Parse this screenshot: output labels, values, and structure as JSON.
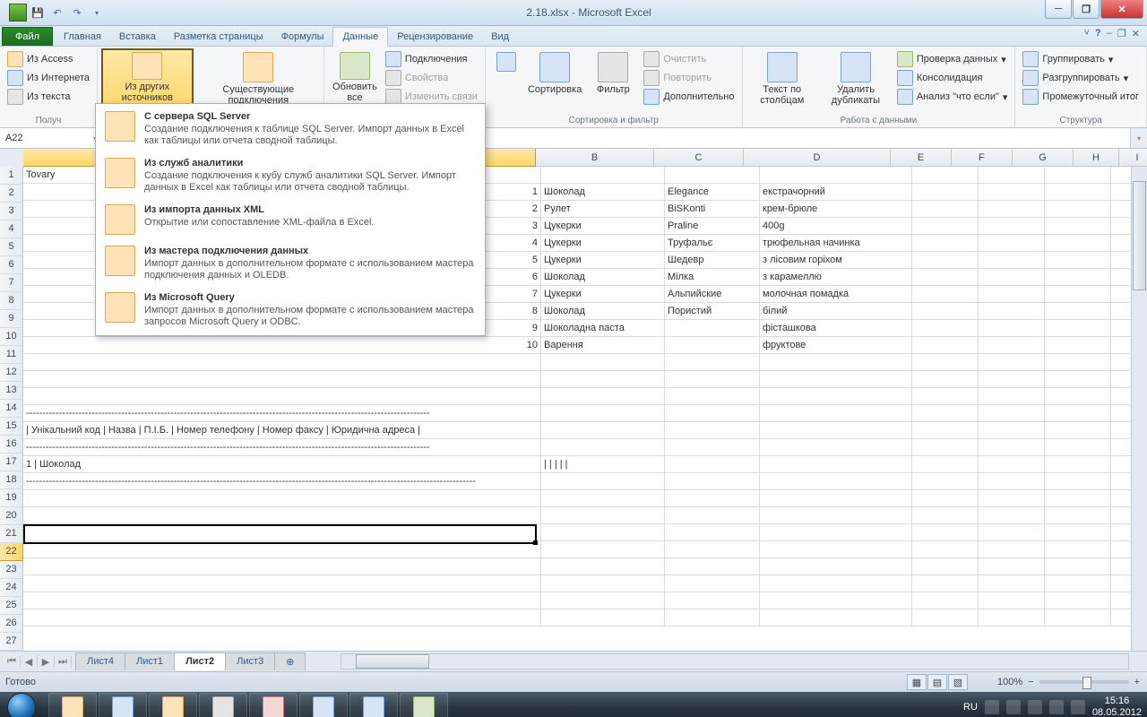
{
  "title_bar": {
    "title": "2.18.xlsx - Microsoft Excel"
  },
  "qat": {
    "save": "💾",
    "undo": "↶",
    "redo": "↷"
  },
  "tabs": {
    "file": "Файл",
    "items": [
      "Главная",
      "Вставка",
      "Разметка страницы",
      "Формулы",
      "Данные",
      "Рецензирование",
      "Вид"
    ],
    "active_index": 4
  },
  "ribbon": {
    "group_get": {
      "label": "Получ",
      "access": "Из Access",
      "web": "Из Интернета",
      "text": "Из текста",
      "other": "Из других источников",
      "existing": "Существующие подключения"
    },
    "group_conn": {
      "refresh": "Обновить все",
      "connections": "Подключения",
      "properties": "Свойства",
      "edit_links": "Изменить связи"
    },
    "group_sort": {
      "label": "Сортировка и фильтр",
      "sort": "Сортировка",
      "filter": "Фильтр",
      "clear": "Очистить",
      "reapply": "Повторить",
      "advanced": "Дополнительно"
    },
    "group_data": {
      "label": "Работа с данными",
      "text_to_cols": "Текст по столбцам",
      "remove_dup": "Удалить дубликаты",
      "validation": "Проверка данных",
      "consolidate": "Консолидация",
      "whatif": "Анализ \"что если\""
    },
    "group_outline": {
      "label": "Структура",
      "group": "Группировать",
      "ungroup": "Разгруппировать",
      "subtotal": "Промежуточный итог"
    }
  },
  "dropdown": [
    {
      "title": "С сервера SQL Server",
      "desc": "Создание подключения к таблице SQL Server. Импорт данных в Excel как таблицы или отчета сводной таблицы."
    },
    {
      "title": "Из служб аналитики",
      "desc": "Создание подключения к кубу служб аналитики SQL Server. Импорт данных в Excel как таблицы или отчета сводной таблицы."
    },
    {
      "title": "Из импорта данных XML",
      "desc": "Открытие или сопоставление XML-файла в Excel."
    },
    {
      "title": "Из мастера подключения данных",
      "desc": "Импорт данных в дополнительном формате с использованием мастера подключения данных и OLEDB."
    },
    {
      "title": "Из Microsoft Query",
      "desc": "Импорт данных в дополнительном формате с использованием мастера запросов Microsoft Query и ODBC."
    }
  ],
  "namebox": "A22",
  "columns": {
    "A": 571,
    "B": 131,
    "C": 99,
    "D": 163,
    "E": 67,
    "F": 67,
    "G": 67,
    "H": 50,
    "I": 40
  },
  "cell_A1": "Tovary",
  "table": [
    {
      "n": "1",
      "b": "Шоколад",
      "c": "Elegance",
      "d": "екстрачорний"
    },
    {
      "n": "2",
      "b": "Рулет",
      "c": "BiSKonti",
      "d": "крем-брюле"
    },
    {
      "n": "3",
      "b": "Цукерки",
      "c": "Praline",
      "d": "400g"
    },
    {
      "n": "4",
      "b": "Цукерки",
      "c": "Труфальє",
      "d": "трюфельная начинка"
    },
    {
      "n": "5",
      "b": "Цукерки",
      "c": "Шедевр",
      "d": "з лісовим горіхом"
    },
    {
      "n": "6",
      "b": "Шоколад",
      "c": "Мілка",
      "d": "з карамеллю"
    },
    {
      "n": "7",
      "b": "Цукерки",
      "c": "Альпийские",
      "d": "молочная помадка"
    },
    {
      "n": "8",
      "b": "Шоколад",
      "c": "Пористий",
      "d": "білий"
    },
    {
      "n": "9",
      "b": "Шоколадна паста",
      "c": "",
      "d": "фісташкова"
    },
    {
      "n": "10",
      "b": "Варення",
      "c": "",
      "d": "фруктове"
    }
  ],
  "row15": "---------------------------------------------------------------------------------------------------------------------------",
  "row16": "| Унікальний код |        Назва        |   П.І.Б.   |  Номер телефону  |  Номер факсу  | Юридична адреса |",
  "row17": "---------------------------------------------------------------------------------------------------------------------------",
  "row18a": "            1 | Шоколад",
  "row18b": "                |              |                |                 |                |",
  "row19": "-----------------------------------------------------------------------------------------------------------------------------------------",
  "sheet_tabs": [
    "Лист4",
    "Лист1",
    "Лист2",
    "Лист3"
  ],
  "sheet_active": 2,
  "status": {
    "ready": "Готово",
    "zoom": "100%",
    "lang": "RU"
  },
  "clock": {
    "time": "15:16",
    "date": "08.05.2012"
  }
}
